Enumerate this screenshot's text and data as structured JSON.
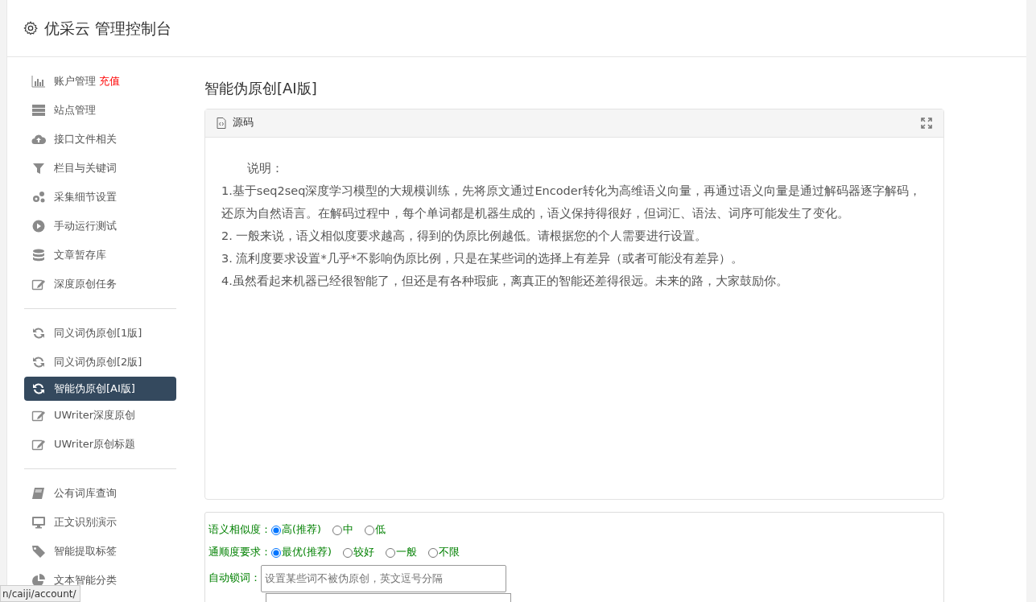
{
  "header": {
    "title": "优采云 管理控制台"
  },
  "sidebar": {
    "groups": [
      {
        "items": [
          {
            "label": "账户管理",
            "badge": "充值",
            "selected": false
          },
          {
            "label": "站点管理",
            "selected": false
          },
          {
            "label": "接口文件相关",
            "selected": false
          },
          {
            "label": "栏目与关键词",
            "selected": false
          },
          {
            "label": "采集细节设置",
            "selected": false
          },
          {
            "label": "手动运行测试",
            "selected": false
          },
          {
            "label": "文章暂存库",
            "selected": false
          },
          {
            "label": "深度原创任务",
            "selected": false
          }
        ]
      },
      {
        "items": [
          {
            "label": "同义词伪原创[1版]",
            "selected": false
          },
          {
            "label": "同义词伪原创[2版]",
            "selected": false
          },
          {
            "label": "智能伪原创[AI版]",
            "selected": true
          },
          {
            "label": "UWriter深度原创",
            "selected": false
          },
          {
            "label": "UWriter原创标题",
            "selected": false
          }
        ]
      },
      {
        "items": [
          {
            "label": "公有词库查询",
            "selected": false
          },
          {
            "label": "正文识别演示",
            "selected": false
          },
          {
            "label": "智能提取标签",
            "selected": false
          },
          {
            "label": "文本智能分类",
            "selected": false
          }
        ]
      }
    ]
  },
  "page_title": "智能伪原创[AI版]",
  "source_card": {
    "header": "源码",
    "lines": [
      "说明：",
      "1.基于seq2seq深度学习模型的大规模训练，先将原文通过Encoder转化为高维语义向量，再通过语义向量是通过解码器逐字解码，还原为自然语言。在解码过程中，每个单词都是机器生成的，语义保持得很好，但词汇、语法、词序可能发生了变化。",
      "2. 一般来说，语义相似度要求越高，得到的伪原比例越低。请根据您的个人需要进行设置。",
      "3. 流利度要求设置*几乎*不影响伪原比例，只是在某些词的选择上有差异（或者可能没有差异）。",
      "4.虽然看起来机器已经很智能了，但还是有各种瑕疵，离真正的智能还差得很远。未来的路，大家鼓励你。"
    ]
  },
  "options": [
    {
      "label": "语义相似度：",
      "choices": [
        {
          "label": "高(推荐)",
          "selected": true
        },
        {
          "label": "中",
          "selected": false
        },
        {
          "label": "低",
          "selected": false
        }
      ]
    },
    {
      "label": "通顺度要求：",
      "choices": [
        {
          "label": "最优(推荐)",
          "selected": true
        },
        {
          "label": "较好",
          "selected": false
        },
        {
          "label": "一般",
          "selected": false
        },
        {
          "label": "不限",
          "selected": false
        }
      ]
    }
  ],
  "lock_words": {
    "label": "自动锁词：",
    "placeholder": "设置某些词不被伪原创，英文逗号分隔"
  },
  "status_url": "n/caiji/account/"
}
